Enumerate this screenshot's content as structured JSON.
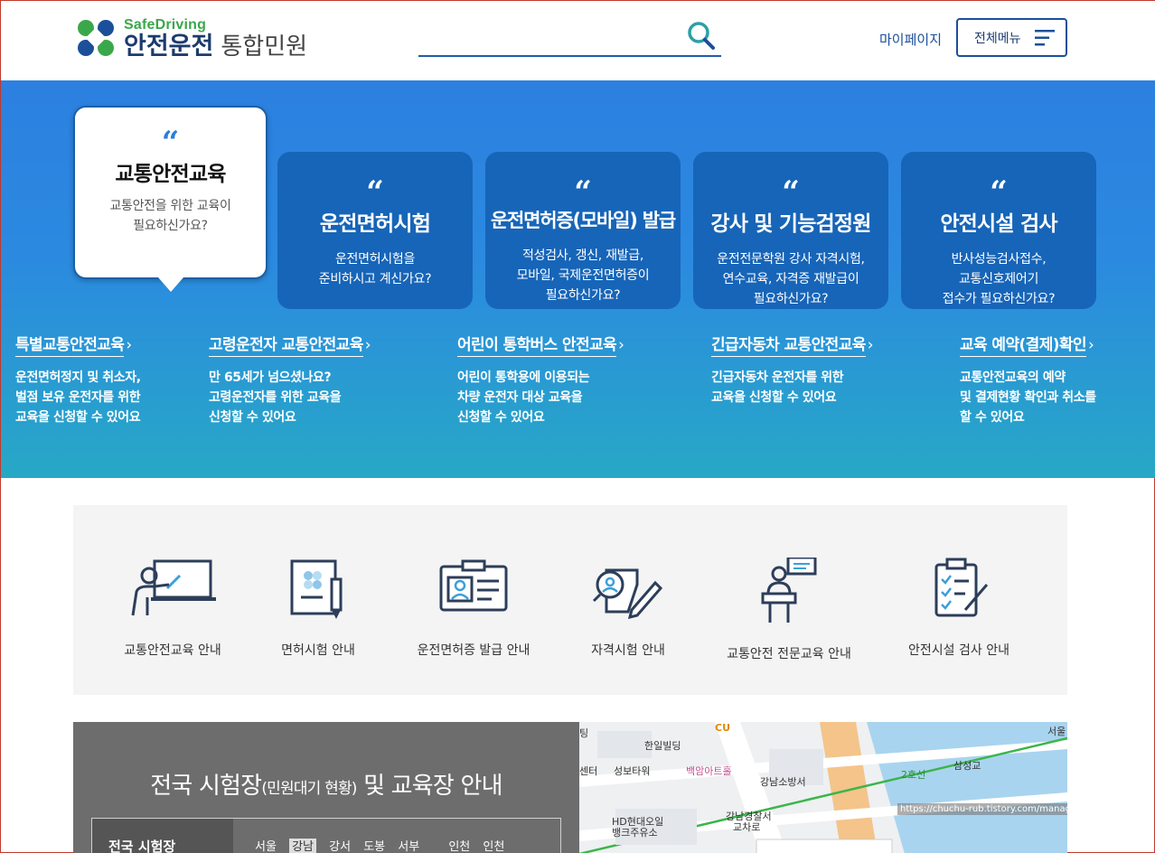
{
  "header": {
    "logo_sub": "SafeDriving",
    "logo_main": "안전운전",
    "logo_service": "통합민원",
    "search_placeholder": "",
    "mypage": "마이페이지",
    "all_menu": "전체메뉴"
  },
  "hero": {
    "cards": [
      {
        "quote": "“",
        "title": "교통안전교육",
        "desc1": "교통안전을 위한 교육이",
        "desc2": "필요하신가요?",
        "desc3": "",
        "active": true
      },
      {
        "quote": "“",
        "title": "운전면허시험",
        "desc1": "운전면허시험을",
        "desc2": "준비하시고 계신가요?",
        "desc3": ""
      },
      {
        "quote": "“",
        "title": "운전면허증(모바일) 발급",
        "desc1": "적성검사, 갱신, 재발급,",
        "desc2": "모바일, 국제운전면허증이",
        "desc3": "필요하신가요?"
      },
      {
        "quote": "“",
        "title": "강사 및 기능검정원",
        "desc1": "운전전문학원 강사 자격시험,",
        "desc2": "연수교육, 자격증 재발급이",
        "desc3": "필요하신가요?"
      },
      {
        "quote": "“",
        "title": "안전시설 검사",
        "desc1": "반사성능검사접수,",
        "desc2": "교통신호제어기",
        "desc3": "접수가 필요하신가요?"
      }
    ],
    "sublinks": [
      {
        "title": "특별교통안전교육",
        "desc1": "운전면허정지 및 취소자,",
        "desc2": "벌점 보유 운전자를 위한",
        "desc3": "교육을 신청할 수 있어요"
      },
      {
        "title": "고령운전자 교통안전교육",
        "desc1": "만 65세가 넘으셨나요?",
        "desc2": "고령운전자를 위한 교육을",
        "desc3": "신청할 수 있어요"
      },
      {
        "title": "어린이 통학버스 안전교육",
        "desc1": "어린이 통학용에 이용되는",
        "desc2": "차량 운전자 대상 교육을",
        "desc3": "신청할 수 있어요"
      },
      {
        "title": "긴급자동차 교통안전교육",
        "desc1": "긴급자동차 운전자를 위한",
        "desc2": "교육을 신청할 수 있어요",
        "desc3": ""
      },
      {
        "title": "교육 예약(결제)확인",
        "desc1": "교통안전교육의 예약",
        "desc2": "및 결제현황 확인과 취소를",
        "desc3": "할 수 있어요"
      }
    ],
    "arrow": "›"
  },
  "services": [
    {
      "label": "교통안전교육 안내",
      "icon": "lecture-icon"
    },
    {
      "label": "면허시험 안내",
      "icon": "license-exam-icon"
    },
    {
      "label": "운전면허증 발급 안내",
      "icon": "id-card-icon"
    },
    {
      "label": "자격시험 안내",
      "icon": "qualification-icon"
    },
    {
      "label": "교통안전 전문교육 안내",
      "icon": "speaker-icon"
    },
    {
      "label": "안전시설 검사 안내",
      "icon": "checklist-icon"
    }
  ],
  "exam": {
    "title_main": "전국 시험장",
    "title_paren": "(민원대기 현황)",
    "title_end": "및 교육장 안내",
    "box_label": "전국 시험장",
    "tabs": [
      {
        "label": "서울",
        "selected": false
      },
      {
        "label": "강남",
        "selected": true
      },
      {
        "label": "강서",
        "selected": false
      },
      {
        "label": "도봉",
        "selected": false
      },
      {
        "label": "서부",
        "selected": false
      },
      {
        "label": "인천",
        "selected": false
      },
      {
        "label": "인천",
        "selected": false
      }
    ]
  },
  "map": {
    "labels": [
      "팅",
      "한일빌딩",
      "CU",
      "서울",
      "센터",
      "성보타워",
      "백암아트홀",
      "강남소방서",
      "2호선",
      "삼성교",
      "HD현대오일",
      "뱅크주유소",
      "강남경찰서",
      "교차로"
    ],
    "url": "https://chuchu-rub.tistory.com/manage/newpost/?typ"
  }
}
